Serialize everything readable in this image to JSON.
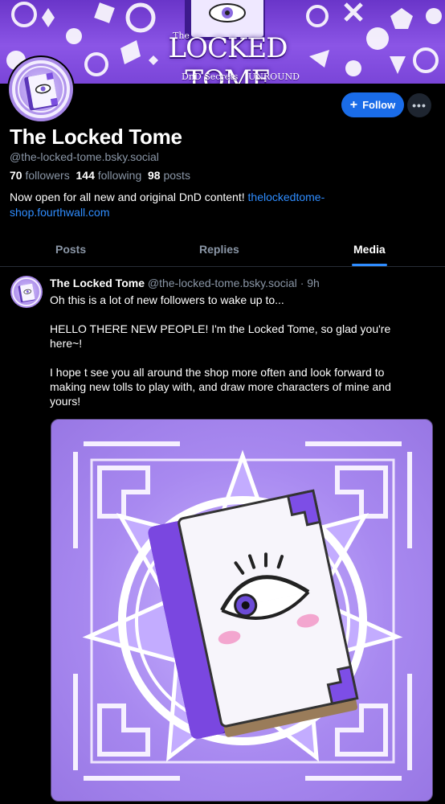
{
  "banner": {
    "the": "The",
    "title": "LOCKED TOME",
    "sub_left": "DnD Secrets",
    "sub_right": "UNROUND"
  },
  "profile": {
    "display_name": "The Locked Tome",
    "handle": "@the-locked-tome.bsky.social",
    "followers_count": "70",
    "followers_label": "followers",
    "following_count": "144",
    "following_label": "following",
    "posts_count": "98",
    "posts_label": "posts",
    "bio_text": "Now open for all new and original DnD content! ",
    "bio_link": "thelockedtome-shop.fourthwall.com"
  },
  "actions": {
    "follow_label": "Follow",
    "follow_icon": "plus-icon",
    "more_icon": "ellipsis-icon"
  },
  "tabs": [
    {
      "label": "Posts",
      "active": false
    },
    {
      "label": "Replies",
      "active": false
    },
    {
      "label": "Media",
      "active": true
    }
  ],
  "post": {
    "author": "The Locked Tome",
    "handle": "@the-locked-tome.bsky.social",
    "separator": "·",
    "time": "9h",
    "paragraphs": [
      "Oh this is a lot of new followers to wake up to...",
      "HELLO THERE NEW PEOPLE! I'm the Locked Tome, so glad you're here~!",
      "I hope t see you all around the shop more often and look forward to making new tolls to play with, and draw more characters of mine and yours!"
    ],
    "image_icon": "book-with-eye-illustration"
  },
  "colors": {
    "background": "#000000",
    "accent": "#1a6ce8",
    "link": "#2f8dff",
    "muted_text": "#8a96a6",
    "banner_purple": "#7a45d8",
    "image_lavender": "#a889f0"
  }
}
